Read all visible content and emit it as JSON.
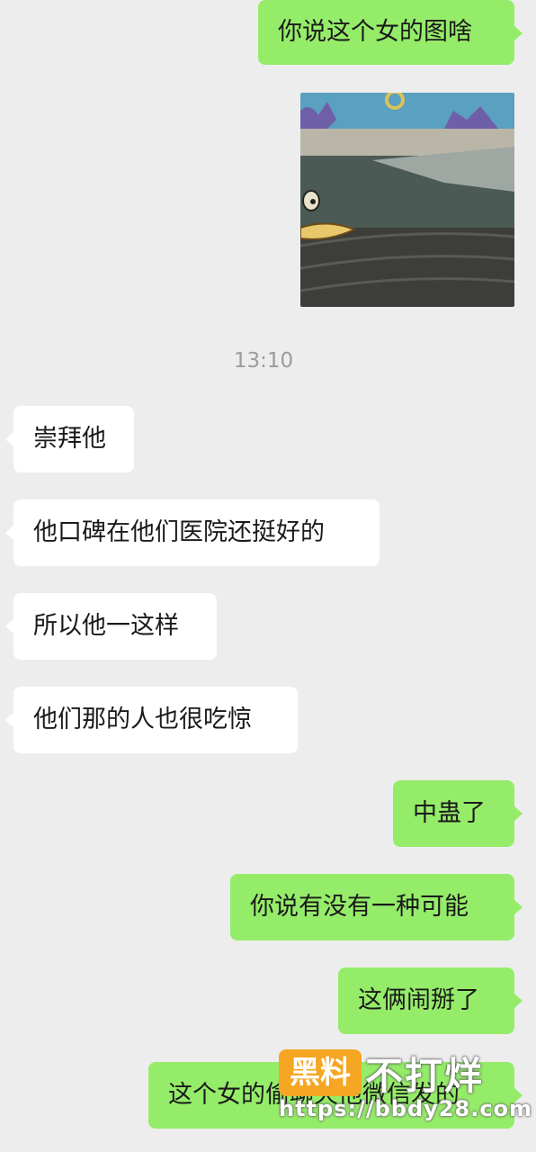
{
  "messages": [
    {
      "side": "out",
      "text": "你说这个女的图啥"
    },
    {
      "side": "in",
      "text": "崇拜他"
    },
    {
      "side": "in",
      "text": "他口碑在他们医院还挺好的"
    },
    {
      "side": "in",
      "text": "所以他一这样"
    },
    {
      "side": "in",
      "text": "他们那的人也很吃惊"
    },
    {
      "side": "out",
      "text": "中蛊了"
    },
    {
      "side": "out",
      "text": "你说有没有一种可能"
    },
    {
      "side": "out",
      "text": "这俩闹掰了"
    },
    {
      "side": "out",
      "text": "这个女的偷聊天他微信发的"
    }
  ],
  "timestamp": "13:10",
  "image_message": {
    "subject": "cartoon-meme-image"
  },
  "watermark": {
    "logo_text": "黑料",
    "brand_text": "不打烊",
    "url": "https://bbdy28.com"
  },
  "colors": {
    "background": "#ededed",
    "outgoing_bubble": "#95ec69",
    "incoming_bubble": "#ffffff",
    "timestamp": "#9b9b9b",
    "watermark_logo": "#f5a623"
  }
}
